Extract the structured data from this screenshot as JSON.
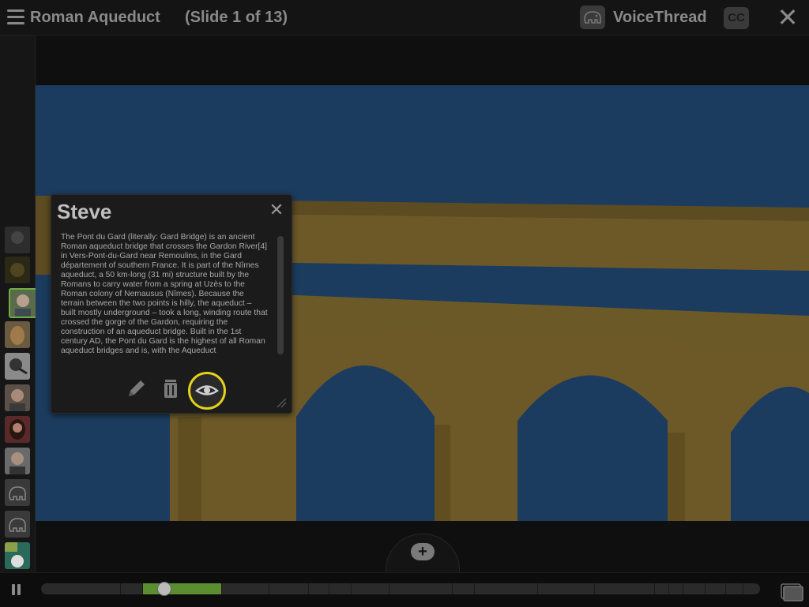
{
  "header": {
    "title": "Roman Aqueduct",
    "slide_indicator": "(Slide 1 of 13)",
    "brand": "VoiceThread",
    "cc_label": "CC"
  },
  "comment": {
    "author": "Steve",
    "text": "The Pont du Gard (literally: Gard Bridge) is an ancient Roman aqueduct bridge that crosses the Gardon River[4] in Vers-Pont-du-Gard near Remoulins, in the Gard département of southern France. It is part of the Nîmes aqueduct, a 50 km-long (31 mi) structure built by the Romans to carry water from a spring at Uzès to the Roman colony of Nemausus (Nîmes). Because the terrain between the two points is hilly, the aqueduct – built mostly underground – took a long, winding route that crossed the gorge of the Gardon, requiring the construction of an aqueduct bridge. Built in the 1st century AD, the Pont du Gard is the highest of all Roman aqueduct bridges and is, with the Aqueduct"
  },
  "playback": {
    "progress": 0.17
  },
  "colors": {
    "accent_green": "#5b8e31",
    "highlight_yellow": "#e6d21c",
    "sky_blue": "#2a5a8e",
    "stone_gold": "#a58a3e"
  },
  "icons": [
    "menu-icon",
    "voicethread-logo-icon",
    "close-icon",
    "pencil-icon",
    "trash-icon",
    "eye-icon",
    "resize-icon",
    "add-comment-icon",
    "pause-icon",
    "slides-icon"
  ]
}
